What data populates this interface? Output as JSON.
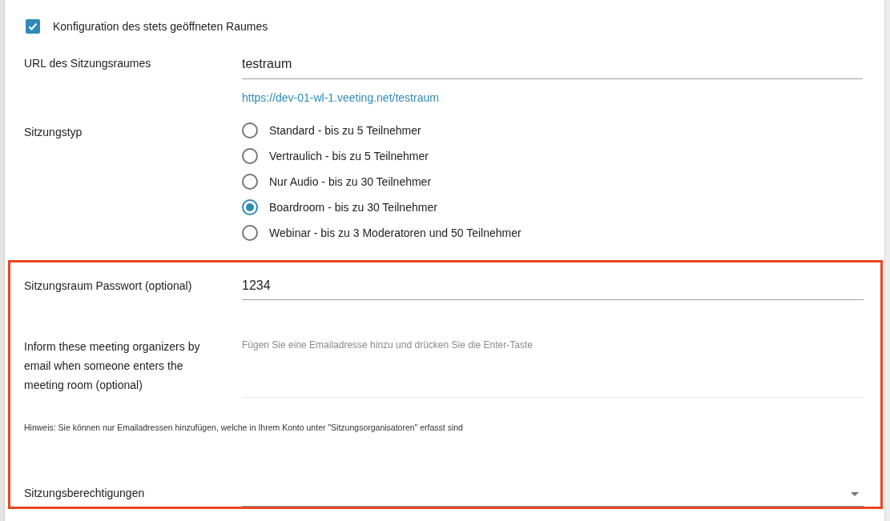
{
  "open_room": {
    "label": "Konfiguration des stets geöffneten Raumes",
    "checked": true
  },
  "url_field": {
    "label": "URL des Sitzungsraumes",
    "value": "testraum",
    "link": "https://dev-01-wl-1.veeting.net/testraum"
  },
  "session_type": {
    "label": "Sitzungstyp",
    "options": [
      {
        "label": "Standard - bis zu 5 Teilnehmer",
        "selected": false
      },
      {
        "label": "Vertraulich - bis zu 5 Teilnehmer",
        "selected": false
      },
      {
        "label": "Nur Audio - bis zu 30 Teilnehmer",
        "selected": false
      },
      {
        "label": "Boardroom - bis zu 30 Teilnehmer",
        "selected": true
      },
      {
        "label": "Webinar - bis zu 3 Moderatoren und 50 Teilnehmer",
        "selected": false
      }
    ]
  },
  "password_field": {
    "label": "Sitzungsraum Passwort (optional)",
    "value": "1234"
  },
  "organizers_field": {
    "label": "Inform these meeting organizers by email when someone enters the meeting room (optional)",
    "placeholder": "Fügen Sie eine Emailadresse hinzu und drücken Sie die Enter-Taste"
  },
  "hint": "Hinweis: Sie können nur Emailadressen hinzufügen, welche in Ihrem Konto unter \"Sitzungsorganisatoren\" erfasst sind",
  "permissions_select": {
    "label": "Sitzungsberechtigungen"
  }
}
